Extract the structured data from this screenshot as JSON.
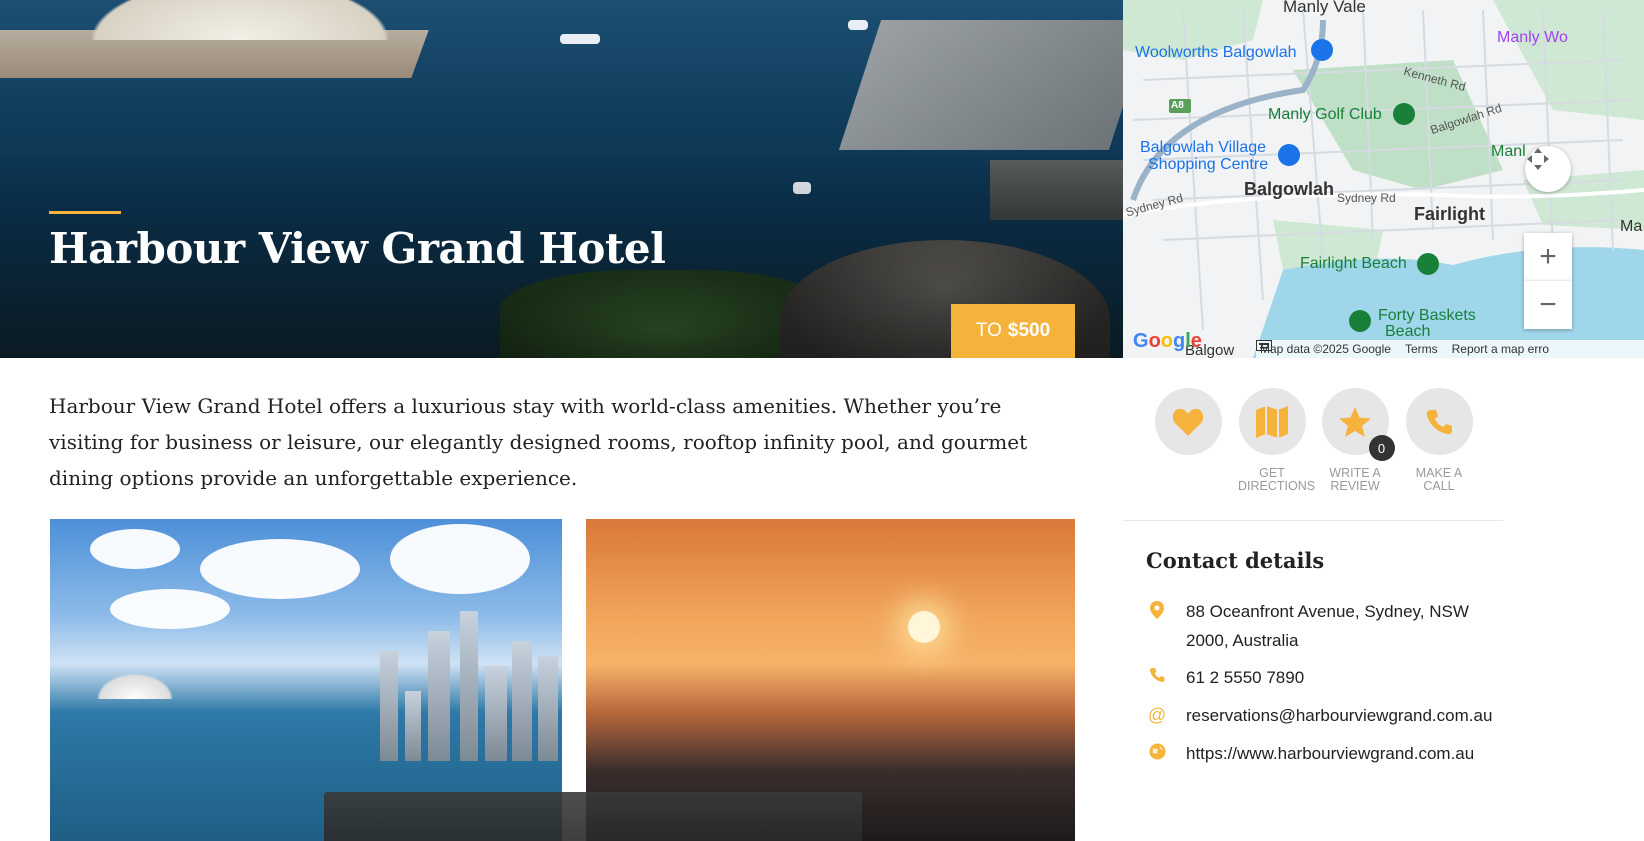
{
  "hero": {
    "title": "Harbour View Grand Hotel",
    "price_prefix": "TO",
    "price_value": "$500",
    "accent_color": "#f6b33b"
  },
  "map": {
    "labels": {
      "manly_vale": "Manly Vale",
      "woolworths": "Woolworths Balgowlah",
      "manly_wo": "Manly Wo",
      "kenneth_rd": "Kenneth Rd",
      "a8": "A8",
      "manly_golf": "Manly Golf Club",
      "balgowlah_rd": "Balgowlah Rd",
      "balgowlah_village": "Balgowlah Village",
      "shopping_centre": "Shopping Centre",
      "manl": "Manl",
      "balgowlah": "Balgowlah",
      "sydney_rd_left": "Sydney Rd",
      "sydney_rd_mid": "Sydney Rd",
      "fairlight": "Fairlight",
      "ma": "Ma",
      "fairlight_beach": "Fairlight Beach",
      "forty_baskets": "Forty Baskets",
      "beach": "Beach",
      "balgow_bottom": "Balgow"
    },
    "attribution": {
      "map_data": "Map data ©2025 Google",
      "terms": "Terms",
      "report": "Report a map erro"
    },
    "google_logo": "Google",
    "controls": {
      "zoom_in": "+",
      "zoom_out": "−"
    }
  },
  "intro_text": "Harbour View Grand Hotel offers a luxurious stay with world-class amenities. Whether you’re visiting for business or leisure, our elegantly designed rooms, rooftop infinity pool, and gourmet dining options provide an unforgettable experience.",
  "actions": [
    {
      "icon": "heart-icon",
      "label": ""
    },
    {
      "icon": "map-icon",
      "label": "GET\nDIRECTIONS"
    },
    {
      "icon": "star-icon",
      "label": "WRITE A\nREVIEW",
      "count": "0"
    },
    {
      "icon": "phone-icon",
      "label": "MAKE A\nCALL"
    }
  ],
  "contact": {
    "title": "Contact details",
    "address": "88 Oceanfront Avenue, Sydney, NSW 2000, Australia",
    "phone": "61 2 5550 7890",
    "email": "reservations@harbourviewgrand.com.au",
    "website": "https://www.harbourviewgrand.com.au"
  }
}
